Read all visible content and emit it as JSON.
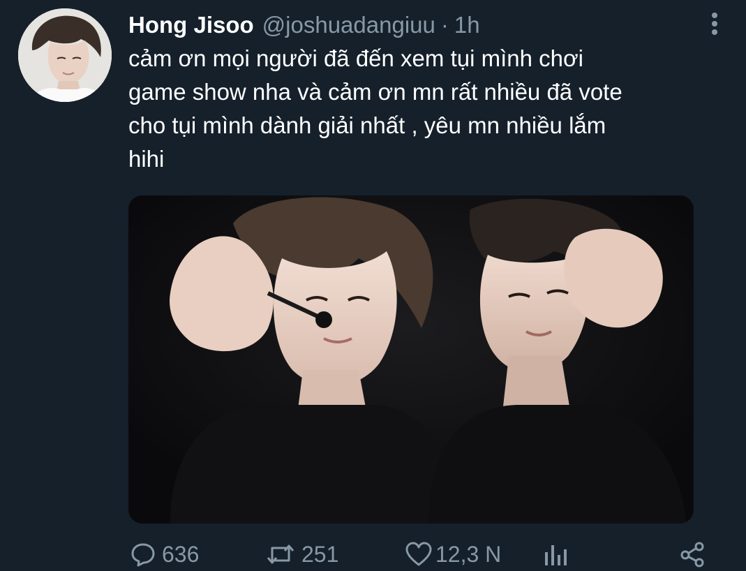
{
  "tweet": {
    "display_name": "Hong Jisoo",
    "handle": "@joshuadangiuu",
    "separator": "·",
    "time": "1h",
    "text_lines": [
      "cảm ơn mọi người đã đến xem tụi mình chơi",
      "game show nha và cảm ơn mn rất nhiều đã vote",
      "cho tụi mình dành giải nhất , yêu mn nhiều lắm",
      "hihi"
    ]
  },
  "actions": {
    "reply_count": "636",
    "retweet_count": "251",
    "like_count": "12,3 N"
  },
  "icons": {
    "avatar": "profile-photo",
    "more": "vertical-dots-icon",
    "reply": "speech-bubble-icon",
    "retweet": "retweet-arrows-icon",
    "like": "heart-icon",
    "analytics": "bar-chart-icon",
    "share": "share-nodes-icon"
  },
  "colors": {
    "background": "#15202b",
    "text_primary": "#ffffff",
    "text_secondary": "#8899a6"
  }
}
